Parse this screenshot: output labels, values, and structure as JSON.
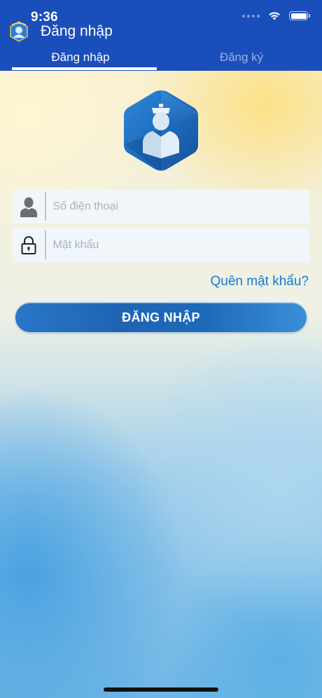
{
  "status_bar": {
    "time": "9:36"
  },
  "header": {
    "title": "Đăng nhập"
  },
  "tabs": [
    {
      "label": "Đăng nhập",
      "active": true
    },
    {
      "label": "Đăng ký",
      "active": false
    }
  ],
  "form": {
    "phone": {
      "placeholder": "Số điện thoại",
      "value": ""
    },
    "password": {
      "placeholder": "Mật khẩu",
      "value": ""
    },
    "forgot_label": "Quên mật khẩu?",
    "submit_label": "ĐĂNG NHẬP"
  },
  "colors": {
    "header": "#1a4ebb",
    "accent": "#1677d8",
    "button": "#1f64b3"
  },
  "icons": [
    "wifi-icon",
    "battery-icon",
    "user-icon",
    "lock-icon"
  ]
}
